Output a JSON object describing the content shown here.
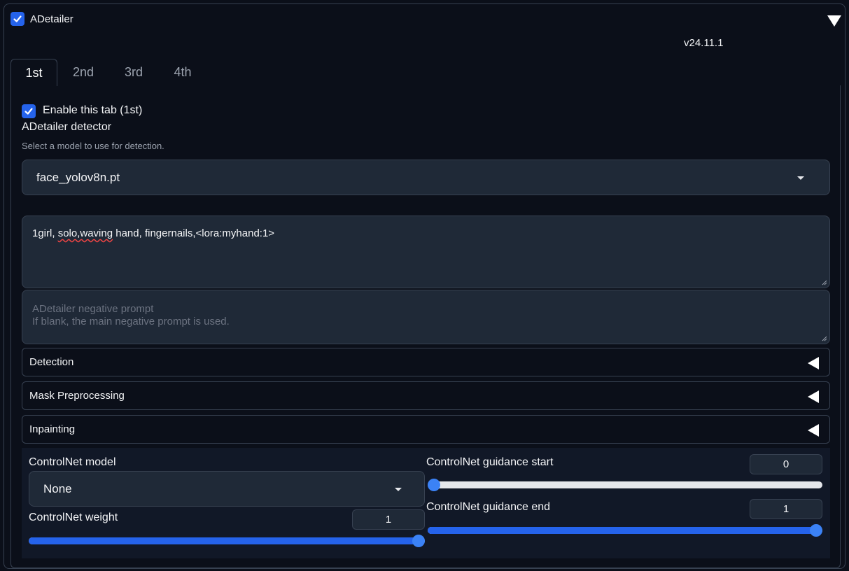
{
  "header": {
    "enabled": true,
    "title": "ADetailer",
    "version": "v24.11.1"
  },
  "tabs": [
    {
      "label": "1st",
      "active": true
    },
    {
      "label": "2nd",
      "active": false
    },
    {
      "label": "3rd",
      "active": false
    },
    {
      "label": "4th",
      "active": false
    }
  ],
  "tab_content": {
    "enable_label": "Enable this tab (1st)",
    "enable_checked": true,
    "detector": {
      "label": "ADetailer detector",
      "info": "Select a model to use for detection.",
      "selected": "face_yolov8n.pt"
    },
    "prompt": {
      "before": "1girl, ",
      "misspelled": "solo,waving",
      "after": " hand, fingernails,<lora:myhand:1>"
    },
    "negative_prompt": {
      "placeholder_line1": "ADetailer negative prompt",
      "placeholder_line2": "If blank, the main negative prompt is used."
    },
    "accordions": [
      {
        "label": "Detection"
      },
      {
        "label": "Mask Preprocessing"
      },
      {
        "label": "Inpainting"
      }
    ],
    "controlnet": {
      "model_label": "ControlNet model",
      "model_selected": "None",
      "weight_label": "ControlNet weight",
      "weight_value": "1",
      "weight_fraction": 1.0,
      "guidance_start_label": "ControlNet guidance start",
      "guidance_start_value": "0",
      "guidance_start_fraction": 0.0,
      "guidance_end_label": "ControlNet guidance end",
      "guidance_end_value": "1",
      "guidance_end_fraction": 1.0
    }
  },
  "colors": {
    "background": "#0b0f19",
    "accent": "#2563eb",
    "border": "#374151",
    "input_bg": "#1f2937"
  }
}
